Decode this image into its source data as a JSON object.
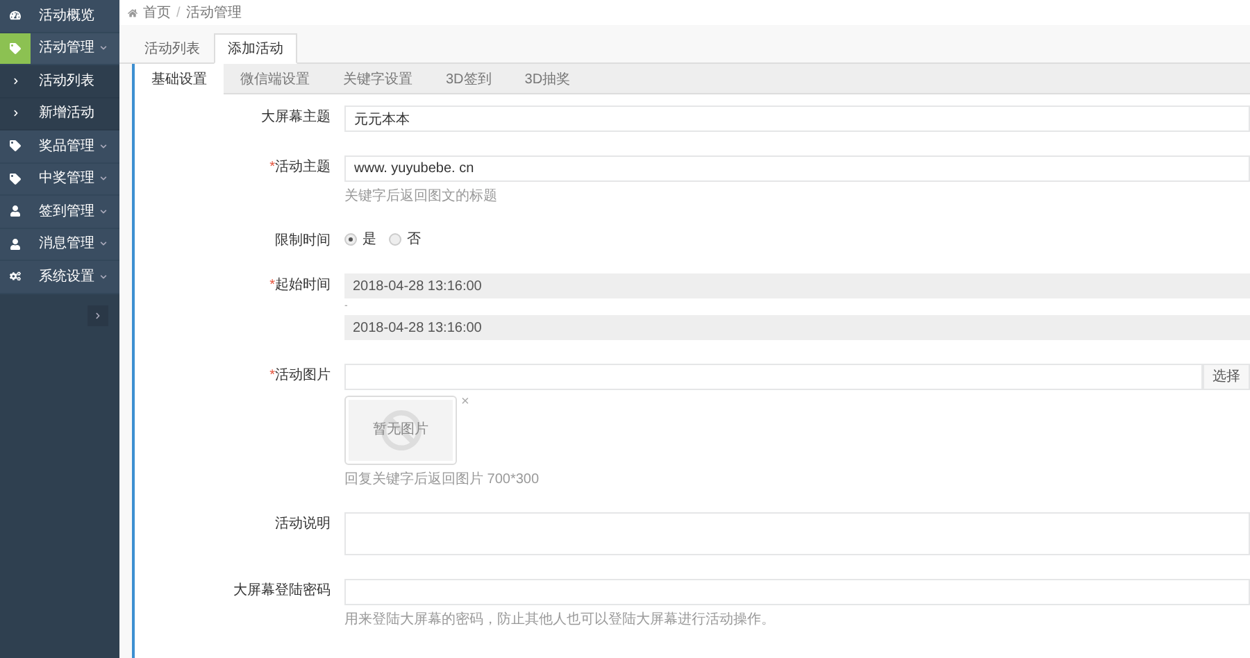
{
  "sidebar": {
    "items": [
      {
        "label": "活动概览",
        "selected": false
      },
      {
        "label": "活动管理",
        "selected": true,
        "expanded": true,
        "children": [
          {
            "label": "活动列表"
          },
          {
            "label": "新增活动"
          }
        ]
      },
      {
        "label": "奖品管理",
        "selected": false
      },
      {
        "label": "中奖管理",
        "selected": false
      },
      {
        "label": "签到管理",
        "selected": false
      },
      {
        "label": "消息管理",
        "selected": false
      },
      {
        "label": "系统设置",
        "selected": false
      }
    ]
  },
  "breadcrumb": [
    {
      "label": "首页"
    },
    {
      "label": "活动管理"
    }
  ],
  "breadcrumb_separator": "/",
  "tabs": [
    {
      "label": "活动列表",
      "selected": false
    },
    {
      "label": "添加活动",
      "selected": true
    }
  ],
  "subtabs": [
    {
      "label": "基础设置",
      "selected": true
    },
    {
      "label": "微信端设置",
      "selected": false
    },
    {
      "label": "关键字设置",
      "selected": false
    },
    {
      "label": "3D签到",
      "selected": false
    },
    {
      "label": "3D抽奖",
      "selected": false
    }
  ],
  "form": {
    "fields": [
      {
        "kind": "text",
        "label": "大屏幕主题",
        "value": "元元本本"
      },
      {
        "kind": "text",
        "label": "活动主题",
        "mark": "*",
        "value": "www. yuyubebe. cn",
        "help": "关键字后返回图文的标题"
      },
      {
        "kind": "radio",
        "label": "限制时间",
        "options": [
          {
            "label": "是",
            "selected": true
          },
          {
            "label": "否",
            "selected": false
          }
        ]
      },
      {
        "kind": "daterange",
        "label": "起始时间",
        "mark": "*",
        "start": "2018-04-28 13:16:00",
        "separator": "-",
        "end": "2018-04-28 13:16:00"
      },
      {
        "kind": "image",
        "label": "活动图片",
        "mark": "*",
        "button": "选择",
        "preview": "暂无图片",
        "remove": "×",
        "help": "回复关键字后返回图片 700*300"
      },
      {
        "kind": "textarea",
        "label": "活动说明"
      },
      {
        "kind": "text",
        "label": "大屏幕登陆密码",
        "help": "用来登陆大屏幕的密码，防止其他人也可以登陆大屏幕进行活动操作。"
      }
    ]
  }
}
